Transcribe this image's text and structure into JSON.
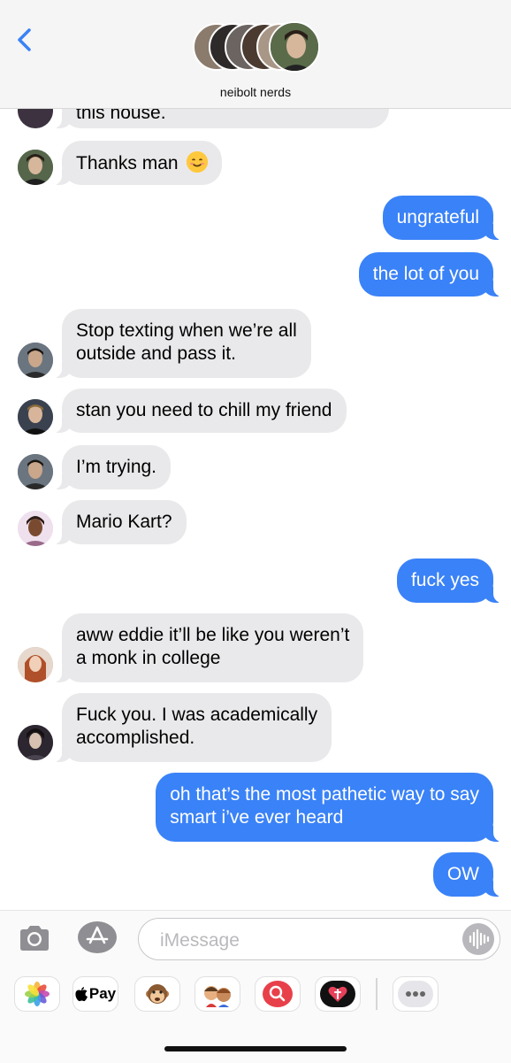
{
  "header": {
    "group_name": "neibolt nerds",
    "back_icon": "chevron-left-icon",
    "accent_color": "#3a82f7"
  },
  "messages": [
    {
      "id": "m0",
      "direction": "in",
      "text": "this house."
    },
    {
      "id": "m1",
      "direction": "in",
      "text": "Thanks man",
      "emoji": "smiling-face-emoji"
    },
    {
      "id": "m2",
      "direction": "out",
      "text": "ungrateful"
    },
    {
      "id": "m3",
      "direction": "out",
      "text": "the lot of you"
    },
    {
      "id": "m4",
      "direction": "in",
      "lines": [
        "Stop texting when we’re all",
        "outside and pass it."
      ]
    },
    {
      "id": "m5",
      "direction": "in",
      "text": "stan you need to chill my friend"
    },
    {
      "id": "m6",
      "direction": "in",
      "text": "I’m trying."
    },
    {
      "id": "m7",
      "direction": "in",
      "text": "Mario Kart?"
    },
    {
      "id": "m8",
      "direction": "out",
      "text": "fuck yes"
    },
    {
      "id": "m9",
      "direction": "in",
      "lines": [
        "aww eddie it’ll be like you weren’t",
        "a monk in college"
      ]
    },
    {
      "id": "m10",
      "direction": "in",
      "lines": [
        "Fuck you. I was academically",
        "accomplished."
      ]
    },
    {
      "id": "m11",
      "direction": "out",
      "lines": [
        "oh that’s the most pathetic way to say",
        "smart i’ve ever heard"
      ]
    },
    {
      "id": "m12",
      "direction": "out",
      "text": "OW"
    }
  ],
  "composer": {
    "placeholder": "iMessage",
    "camera_icon": "camera-icon",
    "appstore_icon": "app-store-icon",
    "audio_icon": "audio-waveform-icon"
  },
  "app_drawer": {
    "apps": [
      {
        "name": "photos-app-icon"
      },
      {
        "name": "apple-pay-app-icon",
        "label": "Pay"
      },
      {
        "name": "animoji-app-icon"
      },
      {
        "name": "memoji-app-icon"
      },
      {
        "name": "images-search-app-icon"
      },
      {
        "name": "digital-touch-app-icon"
      },
      {
        "name": "more-apps-icon"
      }
    ]
  }
}
